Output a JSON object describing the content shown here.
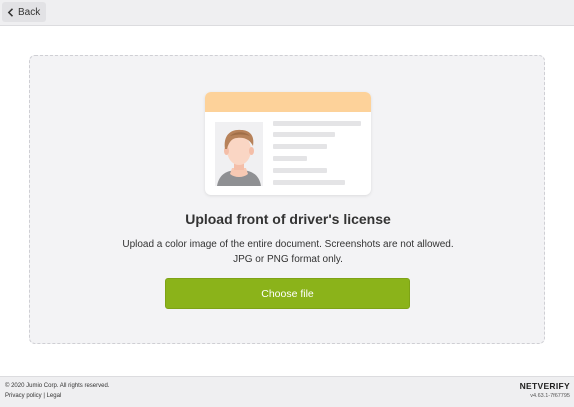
{
  "nav": {
    "back_label": "Back",
    "back_icon": "chevron-left-icon"
  },
  "illustration": {
    "header_color": "#fdd29a",
    "photo_icon": "person-avatar-icon"
  },
  "upload": {
    "title": "Upload front of driver's license",
    "description": "Upload a color image of the entire document. Screenshots are not allowed. JPG or PNG format only.",
    "button_label": "Choose file",
    "button_color": "#8bb31a"
  },
  "footer": {
    "copyright": "© 2020 Jumio Corp. All rights reserved.",
    "privacy_label": "Privacy policy",
    "separator": "|",
    "legal_label": "Legal",
    "brand": "NETVERIFY",
    "version": "v4.63.1-7f67795"
  }
}
